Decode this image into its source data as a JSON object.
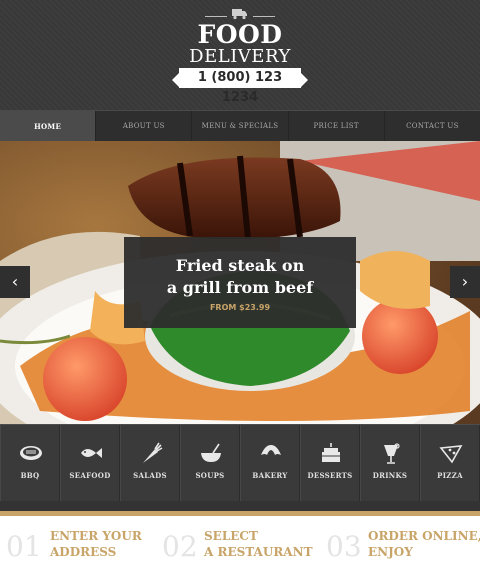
{
  "header": {
    "title_line1": "FOOD",
    "title_line2": "DELIVERY",
    "phone": "1 (800) 123 1234"
  },
  "nav": {
    "items": [
      {
        "label": "HOME",
        "active": true
      },
      {
        "label": "ABOUT US"
      },
      {
        "label": "MENU & SPECIALS"
      },
      {
        "label": "PRICE LIST"
      },
      {
        "label": "CONTACT US"
      }
    ]
  },
  "hero": {
    "caption_line1": "Fried steak on",
    "caption_line2": "a grill from beef",
    "price": "FROM $23.99",
    "prev_icon": "chevron-left-icon",
    "next_icon": "chevron-right-icon"
  },
  "categories": [
    {
      "label": "BBQ",
      "icon": "bbq-icon"
    },
    {
      "label": "SEAFOOD",
      "icon": "fish-icon"
    },
    {
      "label": "SALADS",
      "icon": "carrot-icon"
    },
    {
      "label": "SOUPS",
      "icon": "soup-bowl-icon"
    },
    {
      "label": "BAKERY",
      "icon": "croissant-icon"
    },
    {
      "label": "DESSERTS",
      "icon": "cake-icon"
    },
    {
      "label": "DRINKS",
      "icon": "cocktail-icon"
    },
    {
      "label": "PIZZA",
      "icon": "pizza-icon"
    }
  ],
  "steps": [
    {
      "num": "01",
      "line1": "ENTER YOUR",
      "line2": "ADDRESS"
    },
    {
      "num": "02",
      "line1": "SELECT",
      "line2": "A RESTAURANT"
    },
    {
      "num": "03",
      "line1": "ORDER ONLINE,",
      "line2": "ENJOY"
    }
  ],
  "colors": {
    "accent_gold": "#c8a468",
    "dark": "#3a3a3a",
    "nav_active": "#4b4b4b"
  }
}
